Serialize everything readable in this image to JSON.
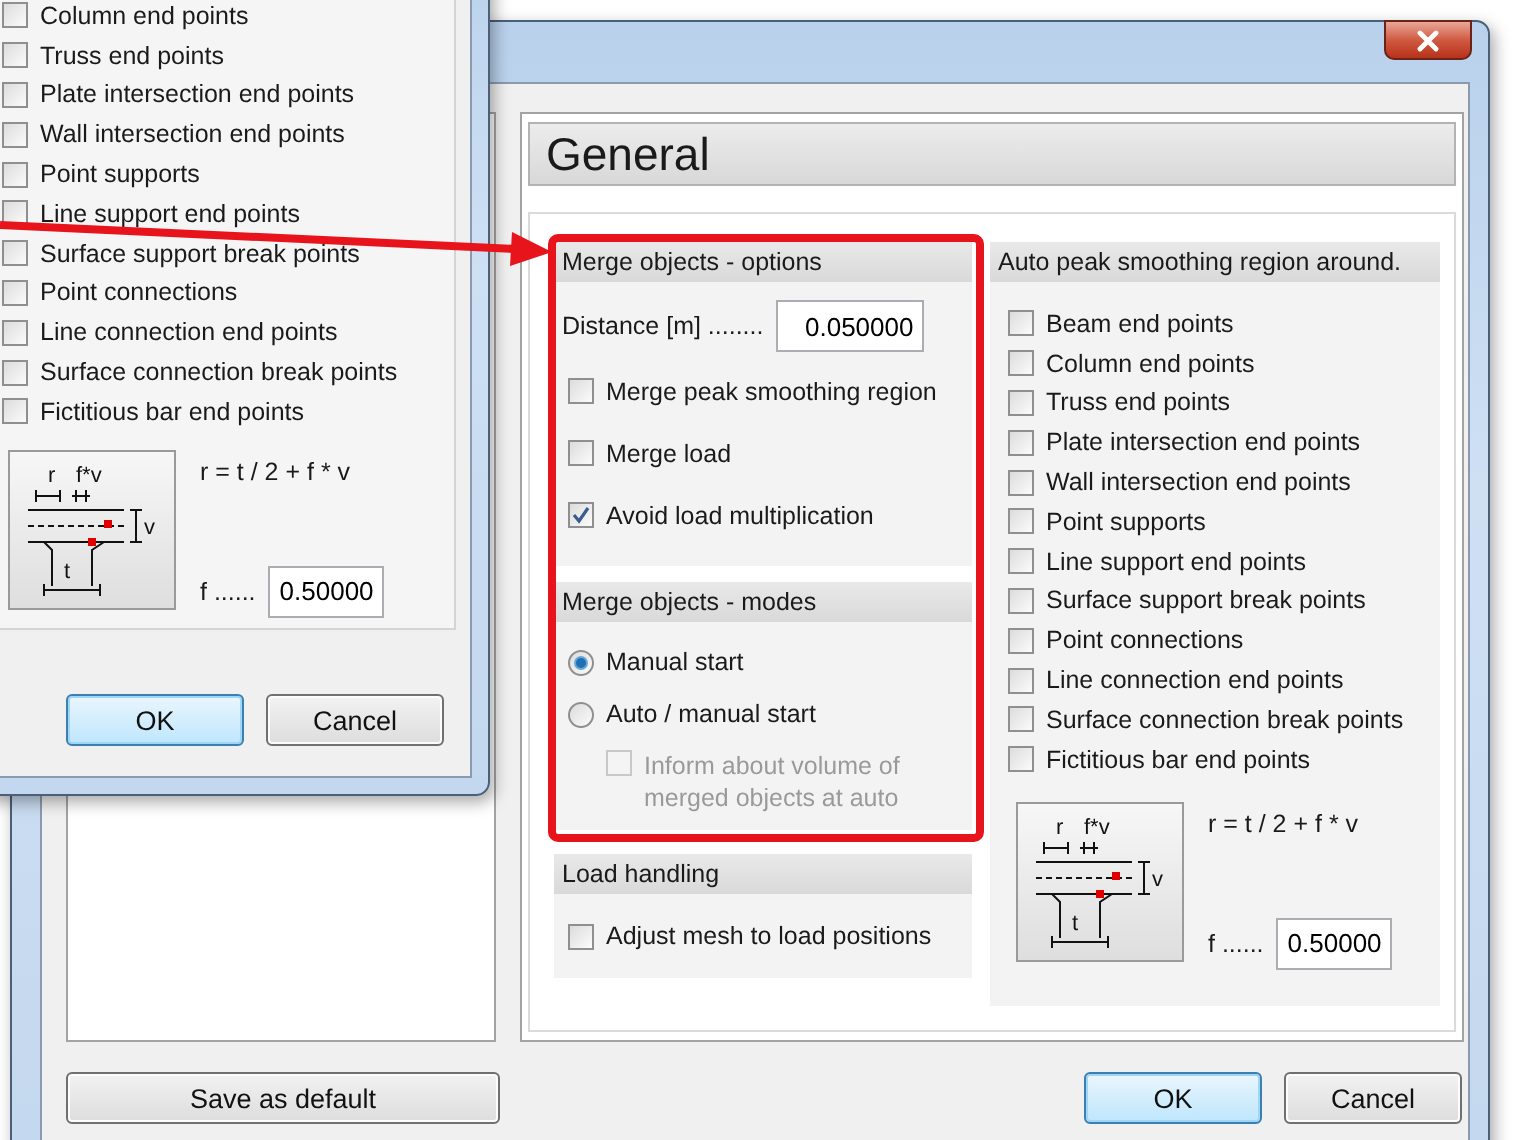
{
  "main_dialog": {
    "page_title": "General",
    "merge_options": {
      "title": "Merge objects - options",
      "distance": {
        "label": "Distance [m] ........",
        "value": "0.050000"
      },
      "checks": [
        {
          "label": "Merge peak smoothing region",
          "checked": false
        },
        {
          "label": "Merge load",
          "checked": false
        },
        {
          "label": "Avoid load multiplication",
          "checked": true
        }
      ]
    },
    "merge_modes": {
      "title": "Merge objects - modes",
      "options": [
        {
          "label": "Manual start",
          "selected": true
        },
        {
          "label": "Auto / manual start",
          "selected": false
        }
      ],
      "inform": {
        "label": "Inform about volume of merged objects at auto",
        "checked": false,
        "disabled": true
      }
    },
    "load_handling": {
      "title": "Load handling",
      "checks": [
        {
          "label": "Adjust mesh to load positions",
          "checked": false
        }
      ]
    },
    "auto_peak": {
      "title": "Auto peak smoothing region around.",
      "items": [
        {
          "label": "Beam end points",
          "checked": false
        },
        {
          "label": "Column end points",
          "checked": false
        },
        {
          "label": "Truss end points",
          "checked": false
        },
        {
          "label": "Plate intersection end points",
          "checked": false
        },
        {
          "label": "Wall intersection end points",
          "checked": false
        },
        {
          "label": "Point supports",
          "checked": false
        },
        {
          "label": "Line support end points",
          "checked": false
        },
        {
          "label": "Surface support break points",
          "checked": false
        },
        {
          "label": "Point connections",
          "checked": false
        },
        {
          "label": "Line connection end points",
          "checked": false
        },
        {
          "label": "Surface connection break points",
          "checked": false
        },
        {
          "label": "Fictitious bar end points",
          "checked": false
        }
      ],
      "diagram_labels": [
        "r",
        "f*v",
        "v",
        "t"
      ],
      "formula": "r = t / 2 + f * v",
      "factor": {
        "label": "f ......",
        "value": "0.50000"
      }
    },
    "save_default": "Save as default",
    "buttons": [
      {
        "label": "OK",
        "default": true
      },
      {
        "label": "Cancel",
        "default": false
      }
    ]
  },
  "front_dialog": {
    "items": [
      {
        "label": "Column end points",
        "checked": false
      },
      {
        "label": "Truss end points",
        "checked": false
      },
      {
        "label": "Plate intersection end points",
        "checked": false
      },
      {
        "label": "Wall intersection end points",
        "checked": false
      },
      {
        "label": "Point supports",
        "checked": false
      },
      {
        "label": "Line support end points",
        "checked": false
      },
      {
        "label": "Surface support break points",
        "checked": false
      },
      {
        "label": "Point connections",
        "checked": false
      },
      {
        "label": "Line connection end points",
        "checked": false
      },
      {
        "label": "Surface connection break points",
        "checked": false
      },
      {
        "label": "Fictitious bar end points",
        "checked": false
      }
    ],
    "diagram_labels": [
      "r",
      "f*v",
      "v",
      "t"
    ],
    "formula": "r = t / 2 + f * v",
    "factor": {
      "label": "f ......",
      "value": "0.50000"
    },
    "buttons": [
      {
        "label": "OK",
        "default": true
      },
      {
        "label": "Cancel",
        "default": false
      }
    ]
  }
}
